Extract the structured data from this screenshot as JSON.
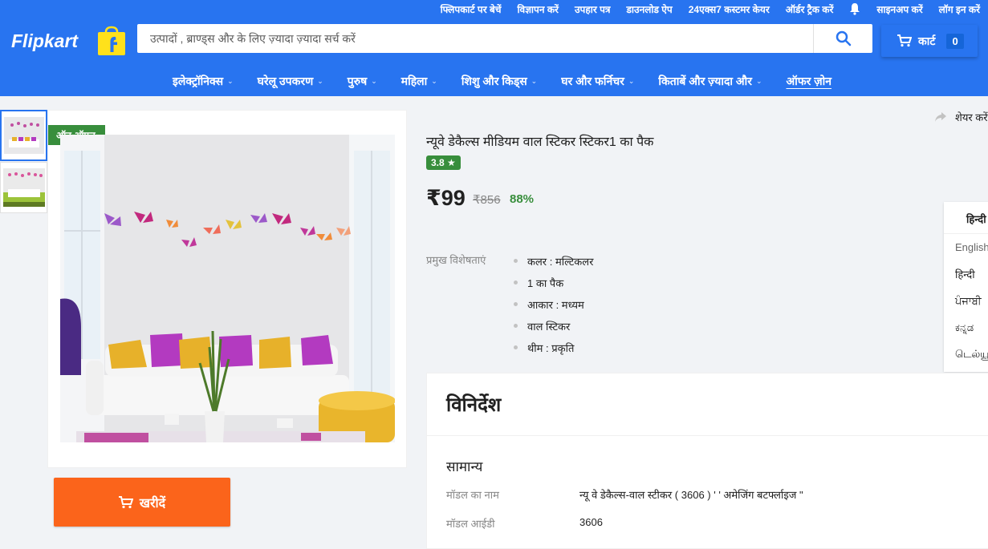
{
  "top_links": [
    "फ्लिपकार्ट पर बेचें",
    "विज्ञापन करें",
    "उपहार पत्र",
    "डाउनलोड ऐप",
    "24एक्स7 कस्टमर केयर",
    "ऑर्डर ट्रैक करें",
    "साइनअप करें",
    "लॉग इन करें"
  ],
  "logo": "Flipkart",
  "search": {
    "placeholder": "उत्पादों , ब्राण्ड्स और के लिए ज़्यादा ज़्यादा सर्च करें"
  },
  "cart": {
    "label": "कार्ट",
    "count": "0"
  },
  "nav": [
    {
      "label": "इलेक्ट्रॉनिक्स"
    },
    {
      "label": "घरेलू उपकरण"
    },
    {
      "label": "पुरुष"
    },
    {
      "label": "महिला"
    },
    {
      "label": "शिशु और किड्स"
    },
    {
      "label": "घर और फर्निचर"
    },
    {
      "label": "किताबें और ज़्यादा और"
    },
    {
      "label": "ऑफर ज़ोन"
    }
  ],
  "product": {
    "badge": "ऑन ऑफर",
    "title": "न्यूवे डेकैल्स मीडियम वाल स्टिकर स्टिकर1 का पैक",
    "rating": "3.8",
    "price": "₹99",
    "mrp": "₹856",
    "discount": "88%",
    "highlights_label": "प्रमुख विशेषताएं",
    "highlights": [
      "कलर : मल्टिकलर",
      "1 का पैक",
      "आकार : मध्यम",
      "वाल स्टिकर",
      "थीम : प्रकृति"
    ],
    "buy_label": "खरीदें",
    "share_label": "शेयर करें"
  },
  "language": {
    "current": "हिन्दी",
    "options": [
      "English",
      "हिन्दी",
      "ਪੰਜਾਬੀ",
      "ಕನ್ನಡ",
      "டெல்யூ"
    ]
  },
  "specs": {
    "heading": "विनिर्देश",
    "section": "सामान्य",
    "rows": [
      {
        "key": "मॉडल का नाम",
        "value": "न्यू वे डेकैल्स-वाल स्टीकर ( 3606 ) ' ' अमेजिंग बटर्फ्लाइज \""
      },
      {
        "key": "मॉडल आईडी",
        "value": "3606"
      }
    ]
  },
  "colors": {
    "brand_blue": "#2874f0",
    "buy_orange": "#fb641b",
    "green": "#388e3c",
    "logo_yellow": "#ffe11b"
  }
}
